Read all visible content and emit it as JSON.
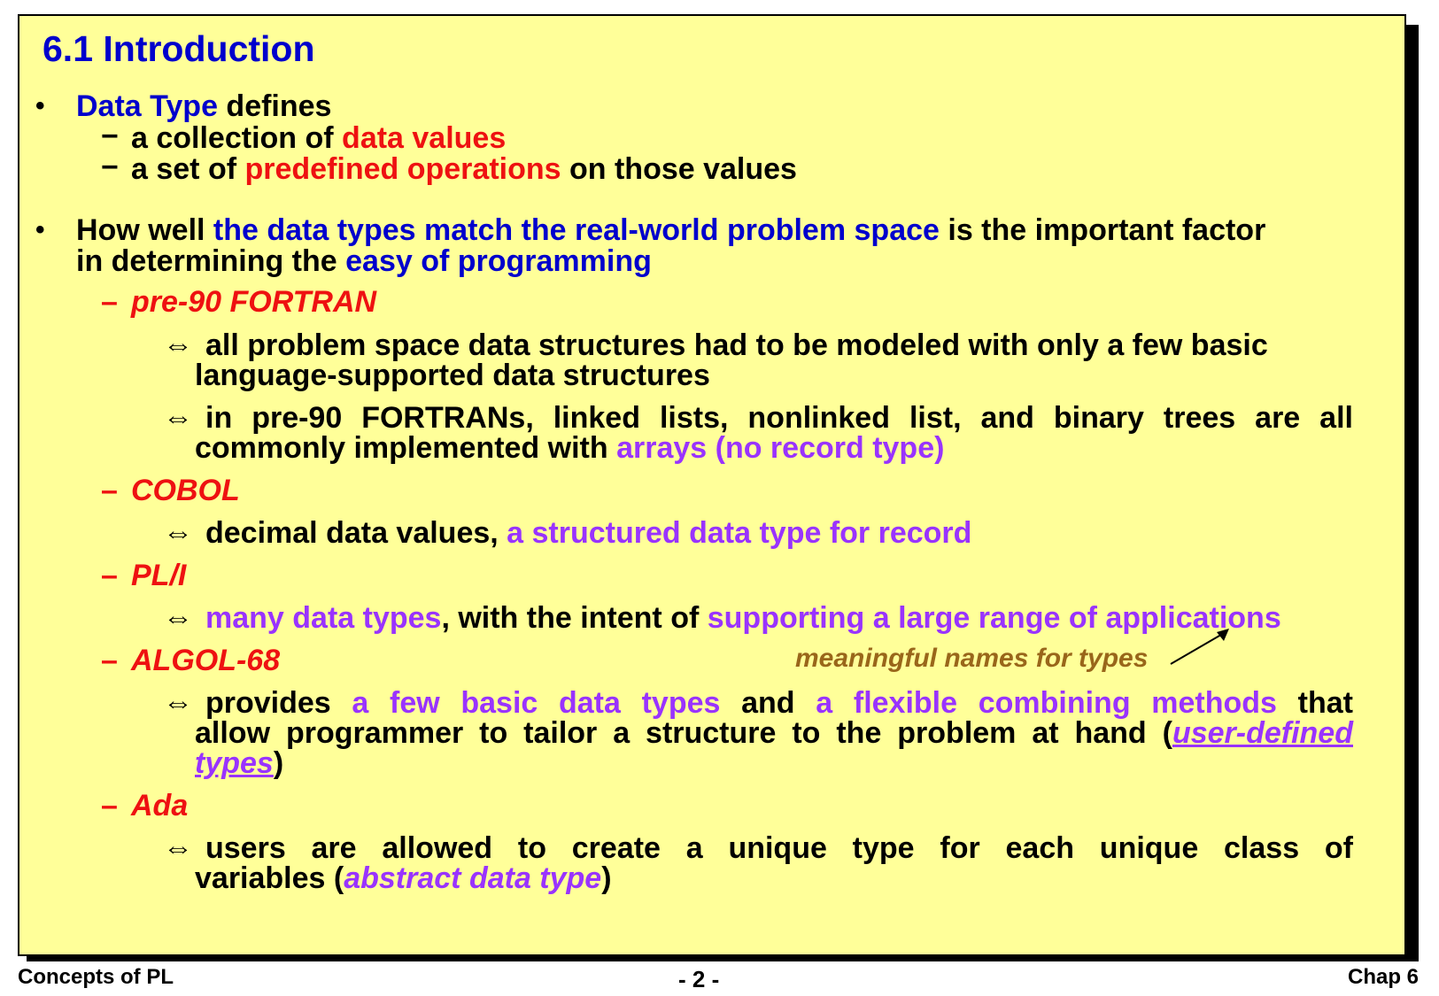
{
  "title": "6.1 Introduction",
  "b1": {
    "bullet": "•",
    "lead_blue": "Data Type",
    "lead_rest": " defines",
    "s1_dash": "−",
    "s1_a": "a collection of ",
    "s1_b": "data values",
    "s2_dash": "−",
    "s2_a": "a set of ",
    "s2_b": "predefined operations",
    "s2_c": " on those values"
  },
  "b2": {
    "bullet": "•",
    "a": "How well ",
    "b": "the data types match the real-world problem space",
    "c": " is the important factor",
    "d": "in determining the ",
    "e": "easy of programming"
  },
  "items": {
    "dash": "–",
    "arrow": "⇔",
    "fortran": {
      "label": "pre-90 FORTRAN",
      "p1_l1": "all problem space data structures had to be modeled with only a few basic",
      "p1_l2": "language-supported data structures",
      "p2_l1": "in pre-90 FORTRANs, linked lists, nonlinked list, and binary trees are all",
      "p2_l2a": "commonly implemented with ",
      "p2_l2b": "arrays (no record type)"
    },
    "cobol": {
      "label": "COBOL",
      "p1a": "decimal data values, ",
      "p1b": "a structured data type for record"
    },
    "pli": {
      "label": "PL/I",
      "p1a": "many data types",
      "p1b": ", with the intent of ",
      "p1c": "supporting a large range of applications"
    },
    "algol": {
      "label": "ALGOL-68",
      "note": "meaningful names for types",
      "p1_l1a": "provides ",
      "p1_l1b": "a few basic data types",
      "p1_l1c": " and ",
      "p1_l1d": "a flexible combining methods",
      "p1_l1e": " that",
      "p1_l2a": "allow programmer to tailor a structure to the problem at hand  (",
      "p1_l2b": "user-defined",
      "p1_l3a": "types",
      "p1_l3b": ")"
    },
    "ada": {
      "label": "Ada",
      "p1_l1": "users are allowed to create a unique type for each unique class of",
      "p1_l2a": "variables (",
      "p1_l2b": "abstract data type",
      "p1_l2c": ")"
    }
  },
  "footer": {
    "left": "Concepts of PL",
    "center": "- 2 -",
    "right": "Chap 6"
  },
  "colors": {
    "background": "#ffff99",
    "blue": "#0000cc",
    "red": "#ee1111",
    "purple": "#9933ff",
    "brown": "#99661a"
  }
}
